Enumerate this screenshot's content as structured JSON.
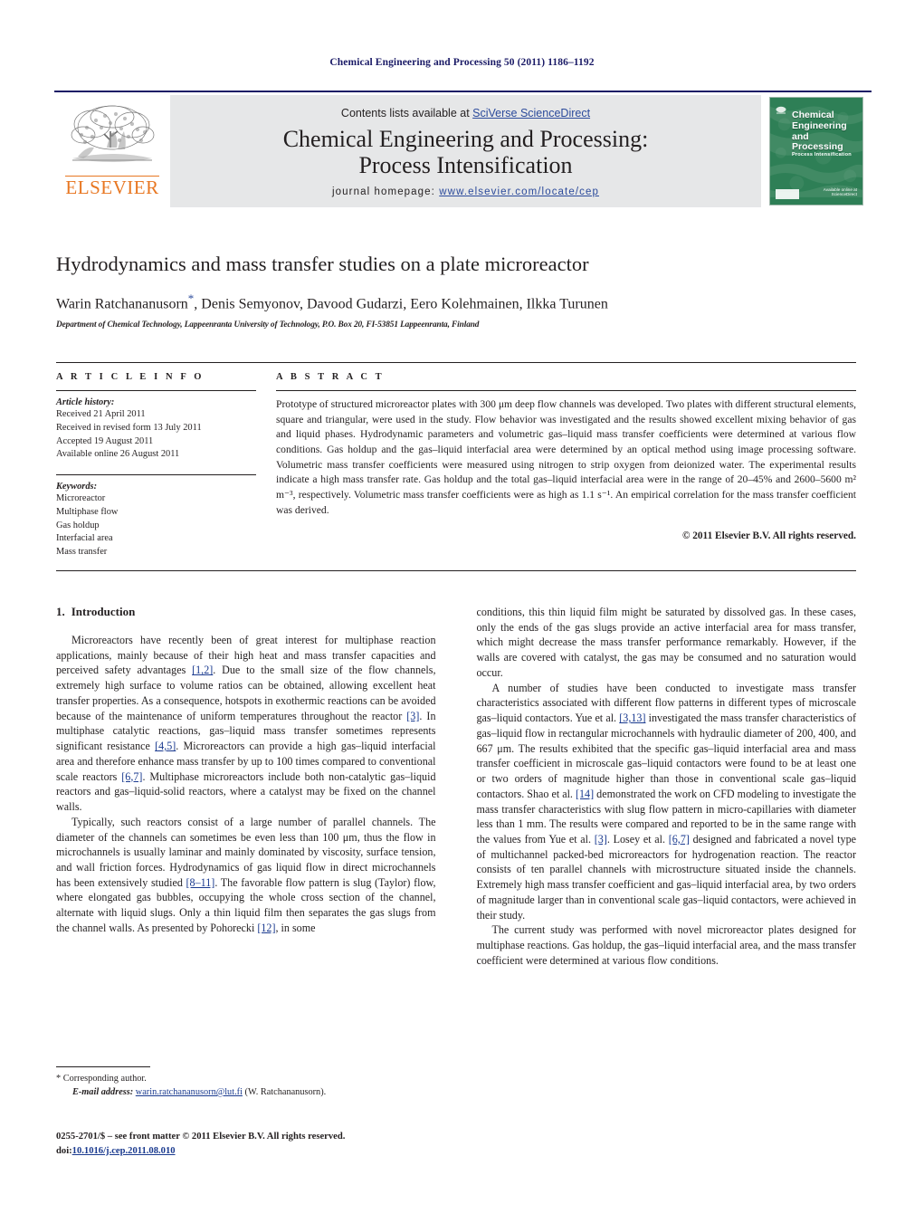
{
  "running_head": "Chemical Engineering and Processing 50 (2011) 1186–1192",
  "masthead": {
    "contents_prefix": "Contents lists available at ",
    "contents_link": "SciVerse ScienceDirect",
    "journal_title_line1": "Chemical Engineering and Processing:",
    "journal_title_line2": "Process Intensification",
    "homepage_prefix": "journal homepage: ",
    "homepage_url": "www.elsevier.com/locate/cep",
    "publisher_name": "ELSEVIER",
    "publisher_logo_icon": "elsevier-tree-icon",
    "cover": {
      "title_line1": "Chemical",
      "title_line2": "Engineering",
      "title_line3": "and",
      "title_line4": "Processing",
      "subtitle": "Process Intensification",
      "footer_line1": "Available online at",
      "footer_line2": "ScienceDirect"
    },
    "colors": {
      "panel_bg": "#e6e7e8",
      "link_blue": "#2b4a9b",
      "elsevier_orange": "#e87722",
      "cover_green": "#2e7d55",
      "rule_navy": "#1a1a66"
    }
  },
  "article": {
    "title": "Hydrodynamics and mass transfer studies on a plate microreactor",
    "authors": "Warin Ratchananusorn*, Denis Semyonov, Davood Gudarzi, Eero Kolehmainen, Ilkka Turunen",
    "authors_before_star": "Warin Ratchananusorn",
    "authors_after_star": ", Denis Semyonov, Davood Gudarzi, Eero Kolehmainen, Ilkka Turunen",
    "corresponding_marker": "*",
    "affiliation": "Department of Chemical Technology, Lappeenranta University of Technology, P.O. Box 20, FI-53851 Lappeenranta, Finland"
  },
  "article_info": {
    "heading": "A R T I C L E  I N F O",
    "history_label": "Article history:",
    "history": [
      "Received 21 April 2011",
      "Received in revised form 13 July 2011",
      "Accepted 19 August 2011",
      "Available online 26 August 2011"
    ],
    "keywords_label": "Keywords:",
    "keywords": [
      "Microreactor",
      "Multiphase flow",
      "Gas holdup",
      "Interfacial area",
      "Mass transfer"
    ]
  },
  "abstract": {
    "heading": "A B S T R A C T",
    "text": "Prototype of structured microreactor plates with 300 μm deep flow channels was developed. Two plates with different structural elements, square and triangular, were used in the study. Flow behavior was investigated and the results showed excellent mixing behavior of gas and liquid phases. Hydrodynamic parameters and volumetric gas–liquid mass transfer coefficients were determined at various flow conditions. Gas holdup and the gas–liquid interfacial area were determined by an optical method using image processing software. Volumetric mass transfer coefficients were measured using nitrogen to strip oxygen from deionized water. The experimental results indicate a high mass transfer rate. Gas holdup and the total gas–liquid interfacial area were in the range of 20–45% and 2600–5600 m² m⁻³, respectively. Volumetric mass transfer coefficients were as high as 1.1 s⁻¹. An empirical correlation for the mass transfer coefficient was derived.",
    "copyright": "© 2011 Elsevier B.V. All rights reserved."
  },
  "body": {
    "section_number": "1.",
    "section_title": "Introduction",
    "left_paragraphs": [
      {
        "segments": [
          {
            "t": "Microreactors have recently been of great interest for multiphase reaction applications, mainly because of their high heat and mass transfer capacities and perceived safety advantages "
          },
          {
            "t": "[1,2]",
            "cite": true
          },
          {
            "t": ". Due to the small size of the flow channels, extremely high surface to volume ratios can be obtained, allowing excellent heat transfer properties. As a consequence, hotspots in exothermic reactions can be avoided because of the maintenance of uniform temperatures throughout the reactor "
          },
          {
            "t": "[3]",
            "cite": true
          },
          {
            "t": ". In multiphase catalytic reactions, gas–liquid mass transfer sometimes represents significant resistance "
          },
          {
            "t": "[4,5]",
            "cite": true
          },
          {
            "t": ". Microreactors can provide a high gas–liquid interfacial area and therefore enhance mass transfer by up to 100 times compared to conventional scale reactors "
          },
          {
            "t": "[6,7]",
            "cite": true
          },
          {
            "t": ". Multiphase microreactors include both non-catalytic gas–liquid reactors and gas–liquid-solid reactors, where a catalyst may be fixed on the channel walls."
          }
        ]
      },
      {
        "segments": [
          {
            "t": "Typically, such reactors consist of a large number of parallel channels. The diameter of the channels can sometimes be even less than 100 μm, thus the flow in microchannels is usually laminar and mainly dominated by viscosity, surface tension, and wall friction forces. Hydrodynamics of gas liquid flow in direct microchannels has been extensively studied "
          },
          {
            "t": "[8–11]",
            "cite": true
          },
          {
            "t": ". The favorable flow pattern is slug (Taylor) flow, where elongated gas bubbles, occupying the whole cross section of the channel, alternate with liquid slugs. Only a thin liquid film then separates the gas slugs from the channel walls. As presented by Pohorecki "
          },
          {
            "t": "[12]",
            "cite": true
          },
          {
            "t": ", in some"
          }
        ]
      }
    ],
    "right_paragraphs": [
      {
        "segments": [
          {
            "t": "conditions, this thin liquid film might be saturated by dissolved gas. In these cases, only the ends of the gas slugs provide an active interfacial area for mass transfer, which might decrease the mass transfer performance remarkably. However, if the walls are covered with catalyst, the gas may be consumed and no saturation would occur."
          }
        ],
        "no_indent": true
      },
      {
        "segments": [
          {
            "t": "A number of studies have been conducted to investigate mass transfer characteristics associated with different flow patterns in different types of microscale gas–liquid contactors. Yue et al. "
          },
          {
            "t": "[3,13]",
            "cite": true
          },
          {
            "t": " investigated the mass transfer characteristics of gas–liquid flow in rectangular microchannels with hydraulic diameter of 200, 400, and 667 μm. The results exhibited that the specific gas–liquid interfacial area and mass transfer coefficient in microscale gas–liquid contactors were found to be at least one or two orders of magnitude higher than those in conventional scale gas–liquid contactors. Shao et al. "
          },
          {
            "t": "[14]",
            "cite": true
          },
          {
            "t": " demonstrated the work on CFD modeling to investigate the mass transfer characteristics with slug flow pattern in micro-capillaries with diameter less than 1 mm. The results were compared and reported to be in the same range with the values from Yue et al. "
          },
          {
            "t": "[3]",
            "cite": true
          },
          {
            "t": ". Losey et al. "
          },
          {
            "t": "[6,7]",
            "cite": true
          },
          {
            "t": " designed and fabricated a novel type of multichannel packed-bed microreactors for hydrogenation reaction. The reactor consists of ten parallel channels with microstructure situated inside the channels. Extremely high mass transfer coefficient and gas–liquid interfacial area, by two orders of magnitude larger than in conventional scale gas–liquid contactors, were achieved in their study."
          }
        ]
      },
      {
        "segments": [
          {
            "t": "The current study was performed with novel microreactor plates designed for multiphase reactions. Gas holdup, the gas–liquid interfacial area, and the mass transfer coefficient were determined at various flow conditions."
          }
        ]
      }
    ]
  },
  "footnote": {
    "corresponding_marker": "*",
    "corresponding_text": "Corresponding author.",
    "email_label": "E-mail address:",
    "email": "warin.ratchananusorn@lut.fi",
    "email_owner": "(W. Ratchananusorn)."
  },
  "footer": {
    "issn_line": "0255-2701/$ – see front matter © 2011 Elsevier B.V. All rights reserved.",
    "doi_label": "doi:",
    "doi": "10.1016/j.cep.2011.08.010"
  }
}
